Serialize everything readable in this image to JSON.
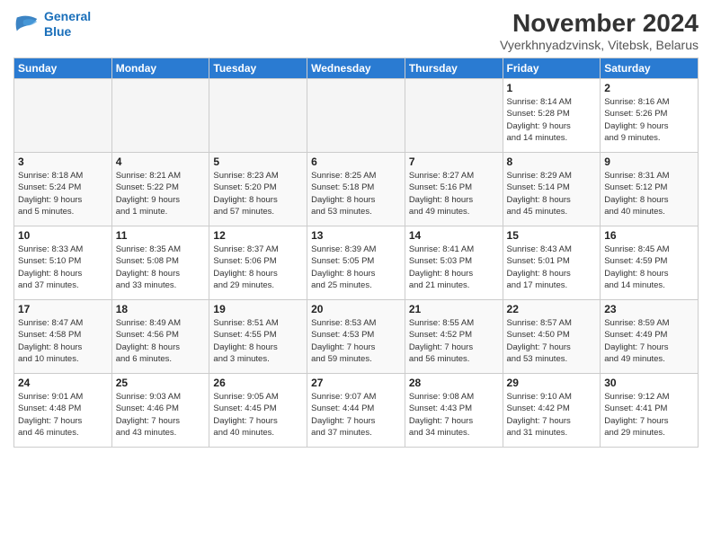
{
  "header": {
    "logo_line1": "General",
    "logo_line2": "Blue",
    "month_title": "November 2024",
    "location": "Vyerkhnyadzvinsk, Vitebsk, Belarus"
  },
  "days_of_week": [
    "Sunday",
    "Monday",
    "Tuesday",
    "Wednesday",
    "Thursday",
    "Friday",
    "Saturday"
  ],
  "weeks": [
    [
      {
        "day": "",
        "info": ""
      },
      {
        "day": "",
        "info": ""
      },
      {
        "day": "",
        "info": ""
      },
      {
        "day": "",
        "info": ""
      },
      {
        "day": "",
        "info": ""
      },
      {
        "day": "1",
        "info": "Sunrise: 8:14 AM\nSunset: 5:28 PM\nDaylight: 9 hours\nand 14 minutes."
      },
      {
        "day": "2",
        "info": "Sunrise: 8:16 AM\nSunset: 5:26 PM\nDaylight: 9 hours\nand 9 minutes."
      }
    ],
    [
      {
        "day": "3",
        "info": "Sunrise: 8:18 AM\nSunset: 5:24 PM\nDaylight: 9 hours\nand 5 minutes."
      },
      {
        "day": "4",
        "info": "Sunrise: 8:21 AM\nSunset: 5:22 PM\nDaylight: 9 hours\nand 1 minute."
      },
      {
        "day": "5",
        "info": "Sunrise: 8:23 AM\nSunset: 5:20 PM\nDaylight: 8 hours\nand 57 minutes."
      },
      {
        "day": "6",
        "info": "Sunrise: 8:25 AM\nSunset: 5:18 PM\nDaylight: 8 hours\nand 53 minutes."
      },
      {
        "day": "7",
        "info": "Sunrise: 8:27 AM\nSunset: 5:16 PM\nDaylight: 8 hours\nand 49 minutes."
      },
      {
        "day": "8",
        "info": "Sunrise: 8:29 AM\nSunset: 5:14 PM\nDaylight: 8 hours\nand 45 minutes."
      },
      {
        "day": "9",
        "info": "Sunrise: 8:31 AM\nSunset: 5:12 PM\nDaylight: 8 hours\nand 40 minutes."
      }
    ],
    [
      {
        "day": "10",
        "info": "Sunrise: 8:33 AM\nSunset: 5:10 PM\nDaylight: 8 hours\nand 37 minutes."
      },
      {
        "day": "11",
        "info": "Sunrise: 8:35 AM\nSunset: 5:08 PM\nDaylight: 8 hours\nand 33 minutes."
      },
      {
        "day": "12",
        "info": "Sunrise: 8:37 AM\nSunset: 5:06 PM\nDaylight: 8 hours\nand 29 minutes."
      },
      {
        "day": "13",
        "info": "Sunrise: 8:39 AM\nSunset: 5:05 PM\nDaylight: 8 hours\nand 25 minutes."
      },
      {
        "day": "14",
        "info": "Sunrise: 8:41 AM\nSunset: 5:03 PM\nDaylight: 8 hours\nand 21 minutes."
      },
      {
        "day": "15",
        "info": "Sunrise: 8:43 AM\nSunset: 5:01 PM\nDaylight: 8 hours\nand 17 minutes."
      },
      {
        "day": "16",
        "info": "Sunrise: 8:45 AM\nSunset: 4:59 PM\nDaylight: 8 hours\nand 14 minutes."
      }
    ],
    [
      {
        "day": "17",
        "info": "Sunrise: 8:47 AM\nSunset: 4:58 PM\nDaylight: 8 hours\nand 10 minutes."
      },
      {
        "day": "18",
        "info": "Sunrise: 8:49 AM\nSunset: 4:56 PM\nDaylight: 8 hours\nand 6 minutes."
      },
      {
        "day": "19",
        "info": "Sunrise: 8:51 AM\nSunset: 4:55 PM\nDaylight: 8 hours\nand 3 minutes."
      },
      {
        "day": "20",
        "info": "Sunrise: 8:53 AM\nSunset: 4:53 PM\nDaylight: 7 hours\nand 59 minutes."
      },
      {
        "day": "21",
        "info": "Sunrise: 8:55 AM\nSunset: 4:52 PM\nDaylight: 7 hours\nand 56 minutes."
      },
      {
        "day": "22",
        "info": "Sunrise: 8:57 AM\nSunset: 4:50 PM\nDaylight: 7 hours\nand 53 minutes."
      },
      {
        "day": "23",
        "info": "Sunrise: 8:59 AM\nSunset: 4:49 PM\nDaylight: 7 hours\nand 49 minutes."
      }
    ],
    [
      {
        "day": "24",
        "info": "Sunrise: 9:01 AM\nSunset: 4:48 PM\nDaylight: 7 hours\nand 46 minutes."
      },
      {
        "day": "25",
        "info": "Sunrise: 9:03 AM\nSunset: 4:46 PM\nDaylight: 7 hours\nand 43 minutes."
      },
      {
        "day": "26",
        "info": "Sunrise: 9:05 AM\nSunset: 4:45 PM\nDaylight: 7 hours\nand 40 minutes."
      },
      {
        "day": "27",
        "info": "Sunrise: 9:07 AM\nSunset: 4:44 PM\nDaylight: 7 hours\nand 37 minutes."
      },
      {
        "day": "28",
        "info": "Sunrise: 9:08 AM\nSunset: 4:43 PM\nDaylight: 7 hours\nand 34 minutes."
      },
      {
        "day": "29",
        "info": "Sunrise: 9:10 AM\nSunset: 4:42 PM\nDaylight: 7 hours\nand 31 minutes."
      },
      {
        "day": "30",
        "info": "Sunrise: 9:12 AM\nSunset: 4:41 PM\nDaylight: 7 hours\nand 29 minutes."
      }
    ]
  ]
}
